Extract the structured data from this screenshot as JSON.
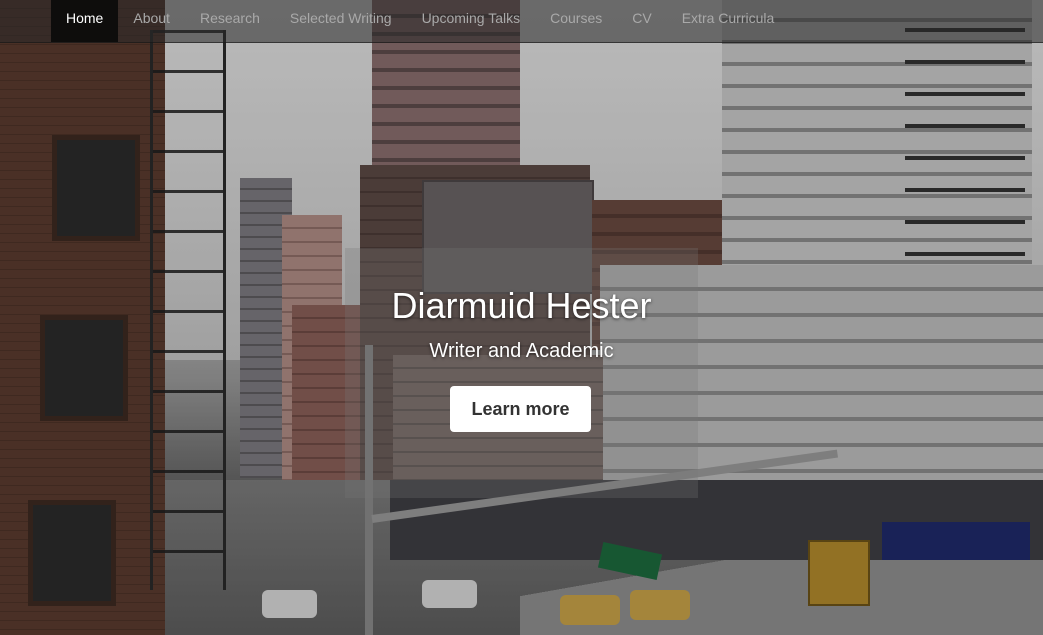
{
  "nav": {
    "items": [
      {
        "label": "Home",
        "active": true
      },
      {
        "label": "About"
      },
      {
        "label": "Research"
      },
      {
        "label": "Selected Writing"
      },
      {
        "label": "Upcoming Talks"
      },
      {
        "label": "Courses"
      },
      {
        "label": "CV"
      },
      {
        "label": "Extra Curricula"
      }
    ]
  },
  "hero": {
    "title": "Diarmuid Hester",
    "subtitle": "Writer and Academic",
    "button_label": "Learn more"
  },
  "colors": {
    "nav_active_bg": "#0a0a0a",
    "nav_text": "#a9a9a9",
    "button_bg": "#ffffff",
    "button_text": "#333333"
  }
}
